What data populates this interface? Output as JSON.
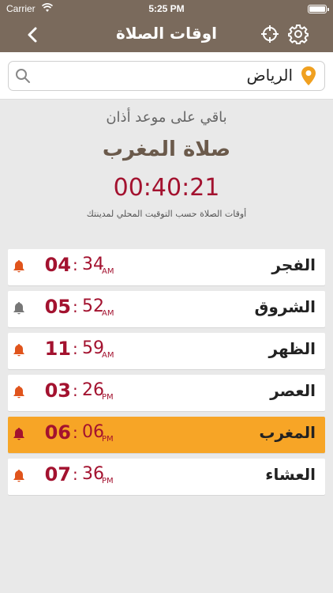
{
  "status_bar": {
    "carrier": "Carrier",
    "time": "5:25 PM"
  },
  "nav": {
    "title": "اوقات الصلاة"
  },
  "search": {
    "city": "الرياض"
  },
  "info": {
    "remaining_label": "باقي على موعد أذان",
    "next_prayer": "صلاة المغرب",
    "countdown": "00:40:21",
    "note": "أوقات الصلاة حسب التوقيت المحلي لمدينتك"
  },
  "prayers": [
    {
      "name": "الفجر",
      "hh": "04",
      "mm": "34",
      "ampm": "AM",
      "bell": "bell-icon",
      "bell_color": "#e0541c",
      "active": false
    },
    {
      "name": "الشروق",
      "hh": "05",
      "mm": "52",
      "ampm": "AM",
      "bell": "bell-icon",
      "bell_color": "#777777",
      "active": false
    },
    {
      "name": "الظهر",
      "hh": "11",
      "mm": "59",
      "ampm": "AM",
      "bell": "bell-icon",
      "bell_color": "#e0541c",
      "active": false
    },
    {
      "name": "العصر",
      "hh": "03",
      "mm": "26",
      "ampm": "PM",
      "bell": "bell-icon",
      "bell_color": "#e0541c",
      "active": false
    },
    {
      "name": "المغرب",
      "hh": "06",
      "mm": "06",
      "ampm": "PM",
      "bell": "bell-icon",
      "bell_color": "#a3122f",
      "active": true
    },
    {
      "name": "العشاء",
      "hh": "07",
      "mm": "36",
      "ampm": "PM",
      "bell": "bell-icon",
      "bell_color": "#e0541c",
      "active": false
    }
  ],
  "colors": {
    "nav": "#7a6a5c",
    "accent": "#a3122f",
    "active_row": "#f7a526",
    "pin": "#f0a020"
  }
}
